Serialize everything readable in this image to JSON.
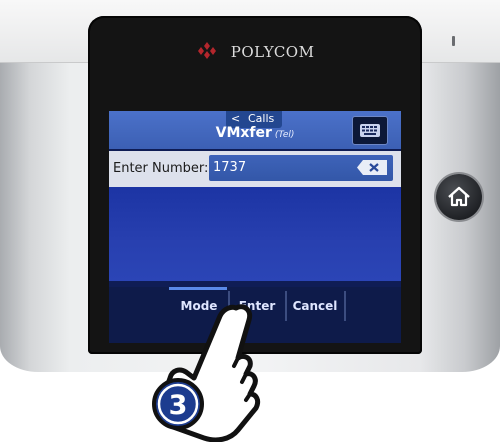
{
  "brand": {
    "name": "POLYCOM"
  },
  "screen": {
    "calls_tab": {
      "arrow": "<",
      "label": "Calls"
    },
    "title": "VMxfer",
    "title_suffix": "(Tel)",
    "input": {
      "label": "Enter Number:",
      "value": "1737"
    },
    "softkeys": {
      "mode": "Mode",
      "enter": "Enter",
      "cancel": "Cancel"
    }
  },
  "hand_step": "3",
  "colors": {
    "screen_blue": "#2840b0",
    "title_bar": "#4b71c9",
    "input_bg": "#dde1ec",
    "softkey_bar": "#0e1b4a",
    "brand_red": "#b3262c",
    "hand_badge": "#1d3c8f"
  },
  "icons": {
    "keyboard": "keyboard-icon",
    "backspace": "backspace-icon",
    "home": "home-icon",
    "brand": "polycom-logo-icon",
    "hand": "pointing-hand-icon"
  }
}
